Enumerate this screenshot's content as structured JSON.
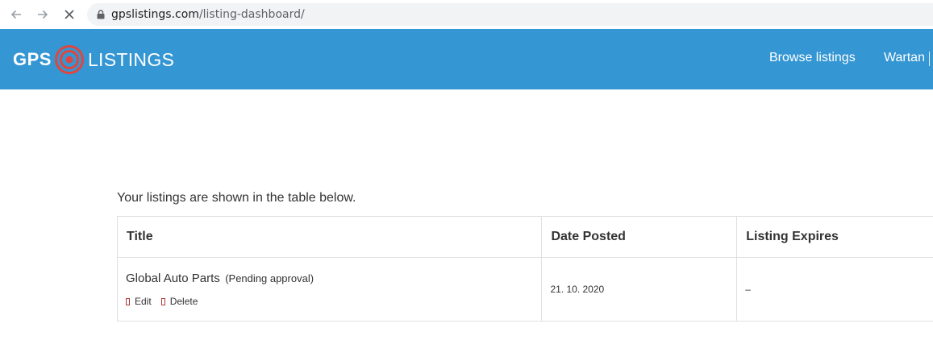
{
  "browser": {
    "url_host": "gpslistings.com",
    "url_path": "/listing-dashboard/"
  },
  "header": {
    "logo_left": "GPS",
    "logo_right": "LISTINGS",
    "nav_browse": "Browse listings",
    "nav_user": "Wartan"
  },
  "main": {
    "intro": "Your listings are shown in the table below.",
    "table": {
      "headers": [
        "Title",
        "Date Posted",
        "Listing Expires"
      ],
      "rows": [
        {
          "title": "Global Auto Parts",
          "status": "(Pending approval)",
          "date_posted": "21. 10. 2020",
          "expires": "–",
          "actions": [
            "Edit",
            "Delete"
          ]
        }
      ]
    }
  },
  "colors": {
    "header_bg": "#3496d3",
    "logo_accent": "#e0463d",
    "action_icon": "#b13a3a"
  },
  "icons": [
    "back-arrow-icon",
    "forward-arrow-icon",
    "stop-loading-icon",
    "lock-icon",
    "gps-target-icon",
    "edit-icon",
    "delete-icon",
    "user-menu-icon"
  ]
}
